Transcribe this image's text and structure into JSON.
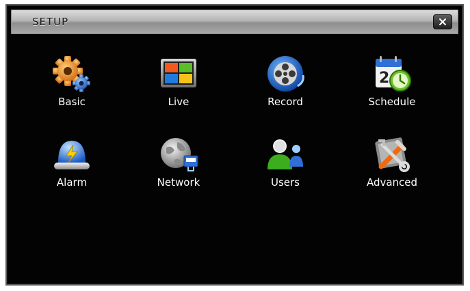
{
  "window": {
    "title": "SETUP",
    "close_symbol": "×"
  },
  "menu": {
    "items": [
      {
        "label": "Basic",
        "icon": "gear-icon"
      },
      {
        "label": "Live",
        "icon": "live-view-icon"
      },
      {
        "label": "Record",
        "icon": "film-reel-icon"
      },
      {
        "label": "Schedule",
        "icon": "calendar-clock-icon"
      },
      {
        "label": "Alarm",
        "icon": "alarm-siren-icon"
      },
      {
        "label": "Network",
        "icon": "globe-network-icon"
      },
      {
        "label": "Users",
        "icon": "users-icon"
      },
      {
        "label": "Advanced",
        "icon": "tools-icon"
      }
    ]
  },
  "colors": {
    "background": "#030303",
    "label": "#ffffff",
    "titlebar": "#b4b4b4"
  }
}
